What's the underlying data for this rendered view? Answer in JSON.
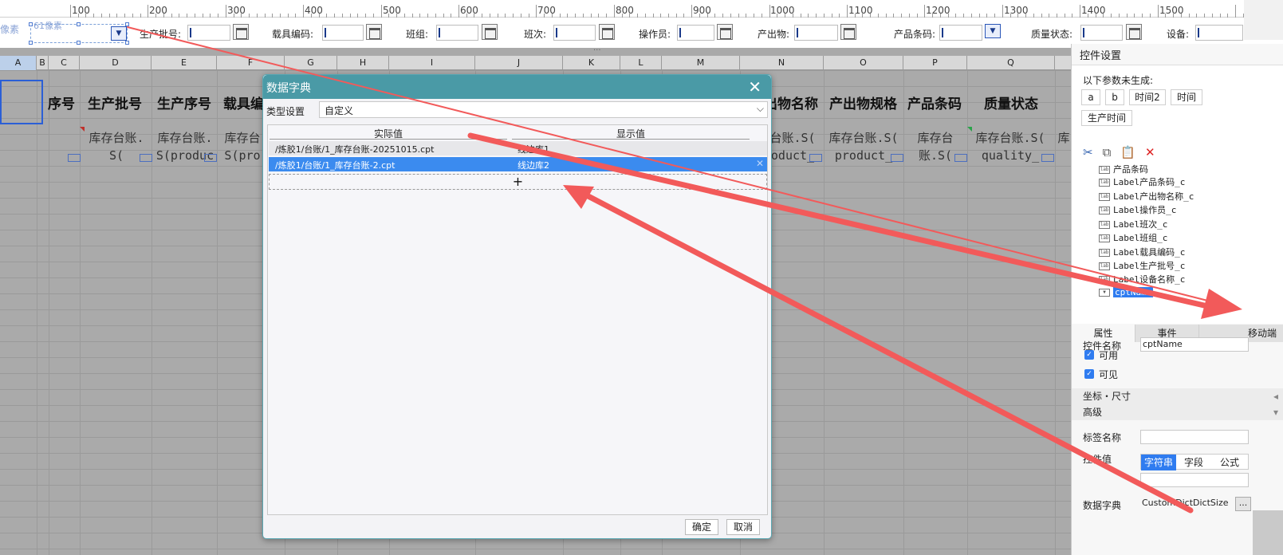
{
  "ruler": {
    "ticks": [
      "100",
      "200",
      "300",
      "400",
      "500",
      "600",
      "700",
      "800",
      "900",
      "1000",
      "1100",
      "1200",
      "1300",
      "1400",
      "1500"
    ]
  },
  "param_bar": {
    "hint_left": "像素",
    "hint_selected": "61像素",
    "labels": [
      "生产批号:",
      "载具编码:",
      "班组:",
      "班次:",
      "操作员:",
      "产出物:",
      "产品条码:",
      "质量状态:",
      "设备:"
    ],
    "more": "..."
  },
  "sheet": {
    "columns": [
      "A",
      "B",
      "C",
      "D",
      "E",
      "F",
      "G",
      "H",
      "I",
      "J",
      "K",
      "L",
      "M",
      "N",
      "O",
      "P",
      "Q"
    ],
    "headers": {
      "seq": "序号",
      "batch": "生产批号",
      "order": "生产序号",
      "carrier": "载具编",
      "out_name": "出物名称",
      "out_spec": "产出物规格",
      "barcode": "产品条码",
      "quality": "质量状态"
    },
    "cells": {
      "d": [
        "库存台账.",
        "S("
      ],
      "e": [
        "库存台账.",
        "S(produc"
      ],
      "f": [
        "库存台",
        "S(pro"
      ],
      "n": [
        "台账.S(",
        "oduct_"
      ],
      "o": [
        "库存台账.S(",
        "product_"
      ],
      "p": [
        "库存台",
        "账.S("
      ],
      "q": [
        "库存台账.S(",
        "quality_"
      ],
      "r": [
        "库"
      ]
    }
  },
  "dialog": {
    "title": "数据字典",
    "close": "✕",
    "type_label": "类型设置",
    "type_value": "自定义",
    "col_actual": "实际值",
    "col_display": "显示值",
    "rows": [
      {
        "actual": "/炼胶1/台账/1_库存台账-20251015.cpt",
        "display": "线边库1"
      },
      {
        "actual": "/炼胶1/台账/1_库存台账-2.cpt",
        "display": "线边库2"
      }
    ],
    "add": "+",
    "delete": "✕",
    "ok": "确定",
    "cancel": "取消"
  },
  "panel": {
    "title": "控件设置",
    "hint": "以下参数未生成:",
    "params": [
      "a",
      "b",
      "时间2",
      "时间",
      "生产时间"
    ],
    "tree": [
      "产品条码",
      "Label产品条码_c",
      "Label产出物名称_c",
      "Label操作员_c",
      "Label班次_c",
      "Label班组_c",
      "Label载具编码_c",
      "Label生产批号_c",
      "Label设备名称_c",
      "cptName"
    ],
    "tabs": [
      "属性",
      "事件",
      "移动端"
    ],
    "props": {
      "name_label": "控件名称",
      "name_value": "cptName",
      "enabled": "可用",
      "visible": "可见",
      "section_geom": "坐标・尺寸",
      "section_adv": "高级",
      "tag_label": "标签名称",
      "value_label": "控件值",
      "value_modes": [
        "字符串",
        "字段",
        "公式"
      ],
      "dict_label": "数据字典",
      "dict_value": "CustomDictDictSize"
    }
  },
  "colors": {
    "dialog_title": "#4a9aa6",
    "selection": "#3b8bef",
    "arrow": "#f25a5a"
  }
}
